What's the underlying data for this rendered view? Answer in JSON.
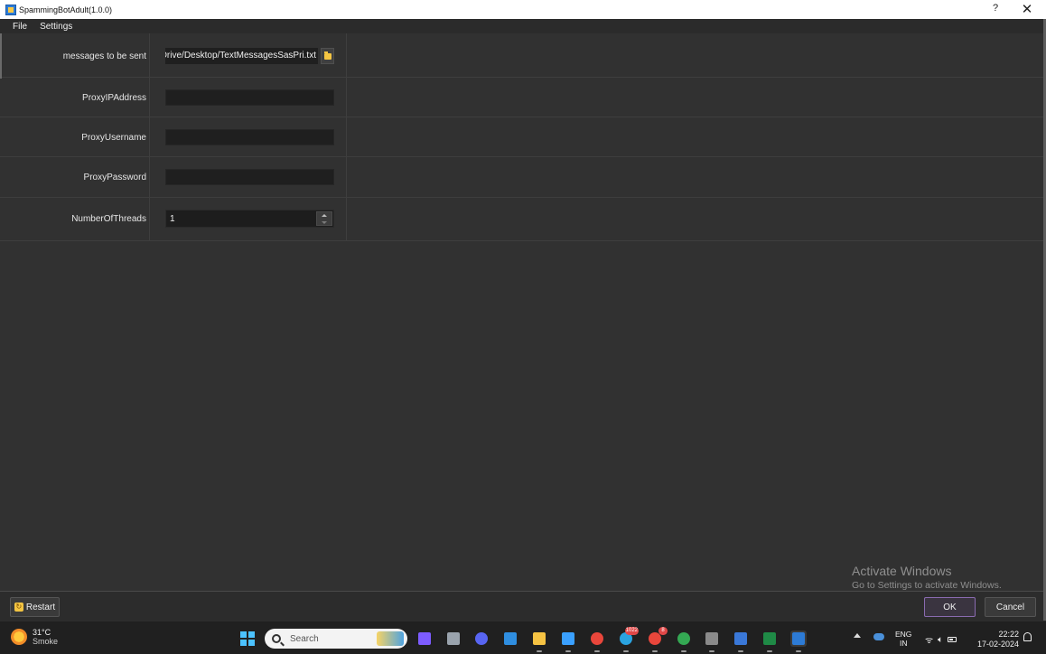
{
  "window": {
    "title": "SpammingBotAdult(1.0.0)",
    "help_label": "?",
    "close_label": "✕"
  },
  "menu": {
    "items": [
      {
        "label": "File"
      },
      {
        "label": "Settings"
      }
    ]
  },
  "form": {
    "messages": {
      "label": "messages to be sent",
      "value": "C:/Users/OneDrive/Desktop/TextMessagesSasPri.txt"
    },
    "proxy_ip": {
      "label": "ProxyIPAddress",
      "value": ""
    },
    "proxy_user": {
      "label": "ProxyUsername",
      "value": ""
    },
    "proxy_pass": {
      "label": "ProxyPassword",
      "value": ""
    },
    "threads": {
      "label": "NumberOfThreads",
      "value": "1"
    }
  },
  "watermark": {
    "line1": "Activate Windows",
    "line2": "Go to Settings to activate Windows."
  },
  "buttons": {
    "restart": "Restart",
    "ok": "OK",
    "cancel": "Cancel"
  },
  "taskbar": {
    "weather": {
      "temp": "31°C",
      "condition": "Smoke"
    },
    "search_placeholder": "Search",
    "apps": [
      {
        "name": "copilot-icon",
        "color": "#7d5cff"
      },
      {
        "name": "task-view-icon",
        "color": "#9aa3ad"
      },
      {
        "name": "meet-icon",
        "color": "#5865f2"
      },
      {
        "name": "store-icon",
        "color": "#2f8ee0"
      },
      {
        "name": "file-explorer-icon",
        "color": "#f6c343"
      },
      {
        "name": "notepad-icon",
        "color": "#3aa0ff"
      },
      {
        "name": "chrome-icon",
        "color": "#e9463b"
      },
      {
        "name": "telegram-icon",
        "color": "#2aa3e0",
        "badge": "1022"
      },
      {
        "name": "chrome-profile-icon",
        "color": "#e9463b",
        "badge": "8"
      },
      {
        "name": "chrome-profile-2-icon",
        "color": "#34a853"
      },
      {
        "name": "dev-tool-icon",
        "color": "#8a8a8a"
      },
      {
        "name": "network-tool-icon",
        "color": "#3a78d8"
      },
      {
        "name": "excel-icon",
        "color": "#1f8a46"
      },
      {
        "name": "spammingbot-app-icon",
        "color": "#2d7bd6"
      }
    ],
    "lang": {
      "line1": "ENG",
      "line2": "IN"
    },
    "clock": {
      "time": "22:22",
      "date": "17-02-2024"
    }
  }
}
